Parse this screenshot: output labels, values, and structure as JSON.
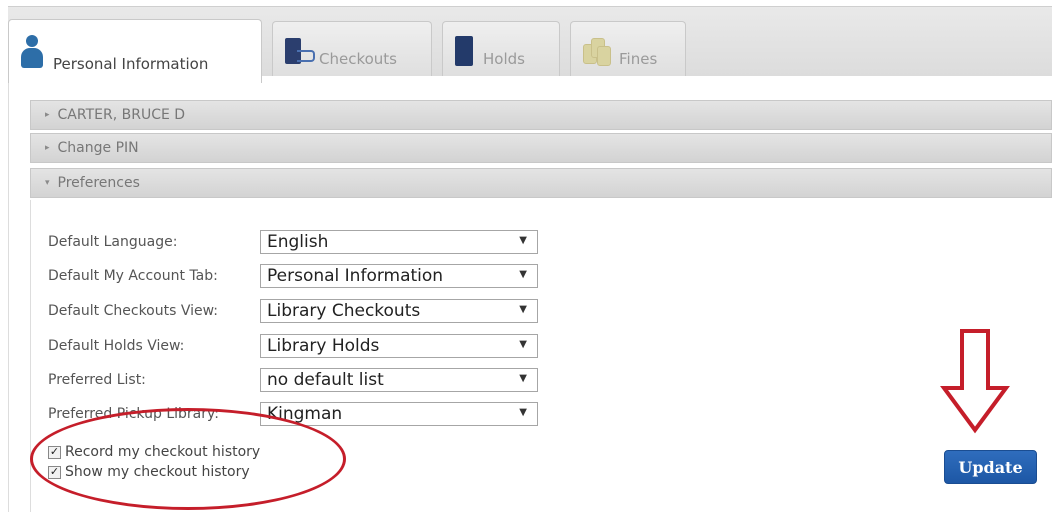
{
  "tabs": [
    {
      "label": "Personal Information",
      "icon": "person-icon",
      "active": true
    },
    {
      "label": "Checkouts",
      "icon": "checkouts-book-icon",
      "active": false
    },
    {
      "label": "Holds",
      "icon": "holds-book-icon",
      "active": false
    },
    {
      "label": "Fines",
      "icon": "coins-icon",
      "active": false
    }
  ],
  "accordion": [
    {
      "label": "CARTER, BRUCE D",
      "expanded": false
    },
    {
      "label": "Change PIN",
      "expanded": false
    },
    {
      "label": "Preferences",
      "expanded": true
    }
  ],
  "preferences": {
    "rows": [
      {
        "label": "Default Language:",
        "value": "English"
      },
      {
        "label": "Default My Account Tab:",
        "value": "Personal Information"
      },
      {
        "label": "Default Checkouts View:",
        "value": "Library Checkouts"
      },
      {
        "label": "Default Holds View:",
        "value": "Library Holds"
      },
      {
        "label": "Preferred List:",
        "value": "no default list"
      },
      {
        "label": "Preferred Pickup Library:",
        "value": "Kingman"
      }
    ],
    "checkboxes": [
      {
        "label": "Record my checkout history",
        "checked": true
      },
      {
        "label": "Show my checkout history",
        "checked": true
      }
    ],
    "update_label": "Update"
  },
  "colors": {
    "accent_blue": "#1d57a5",
    "annotation_red": "#c51e2a"
  }
}
